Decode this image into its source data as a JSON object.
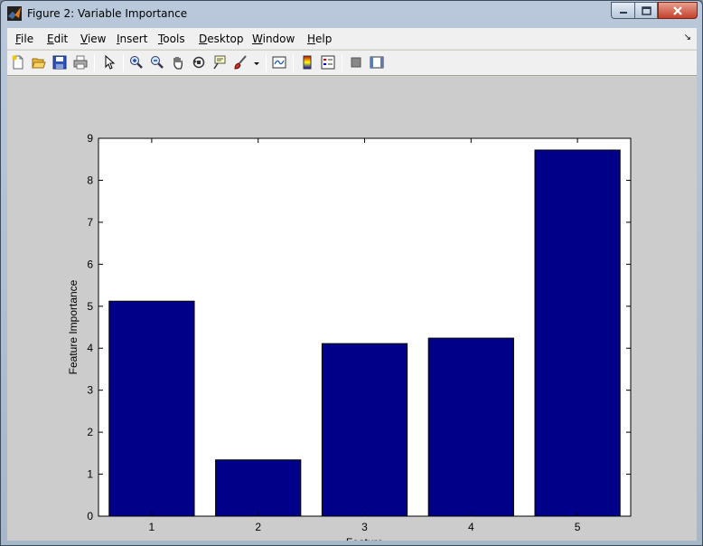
{
  "window": {
    "title": "Figure 2: Variable Importance"
  },
  "menu": {
    "items": [
      {
        "label": "File",
        "mnemonic": "F",
        "rest": "ile"
      },
      {
        "label": "Edit",
        "mnemonic": "E",
        "rest": "dit"
      },
      {
        "label": "View",
        "mnemonic": "V",
        "rest": "iew"
      },
      {
        "label": "Insert",
        "mnemonic": "I",
        "rest": "nsert"
      },
      {
        "label": "Tools",
        "mnemonic": "T",
        "rest": "ools"
      },
      {
        "label": "Desktop",
        "mnemonic": "D",
        "rest": "esktop"
      },
      {
        "label": "Window",
        "mnemonic": "W",
        "rest": "indow"
      },
      {
        "label": "Help",
        "mnemonic": "H",
        "rest": "elp"
      }
    ]
  },
  "toolbar": {
    "icons": [
      "new-figure-icon",
      "open-icon",
      "save-icon",
      "print-icon",
      "select-arrow-icon",
      "zoom-in-icon",
      "zoom-out-icon",
      "pan-hand-icon",
      "rotate-3d-icon",
      "data-cursor-icon",
      "brush-icon",
      "brush-dropdown-icon",
      "link-plot-icon",
      "colorbar-icon",
      "legend-icon",
      "hide-plot-tools-icon",
      "show-plot-tools-icon"
    ]
  },
  "colors": {
    "bar": "#000088",
    "axes_bg": "#ffffff",
    "figure_bg": "#cccccc"
  },
  "chart_data": {
    "type": "bar",
    "categories": [
      "1",
      "2",
      "3",
      "4",
      "5"
    ],
    "values": [
      5.12,
      1.34,
      4.11,
      4.24,
      8.72
    ],
    "title": "",
    "xlabel": "Feature",
    "ylabel": "Feature Importance",
    "ylim": [
      0,
      9
    ],
    "yticks": [
      "0",
      "1",
      "2",
      "3",
      "4",
      "5",
      "6",
      "7",
      "8",
      "9"
    ],
    "grid": false
  }
}
